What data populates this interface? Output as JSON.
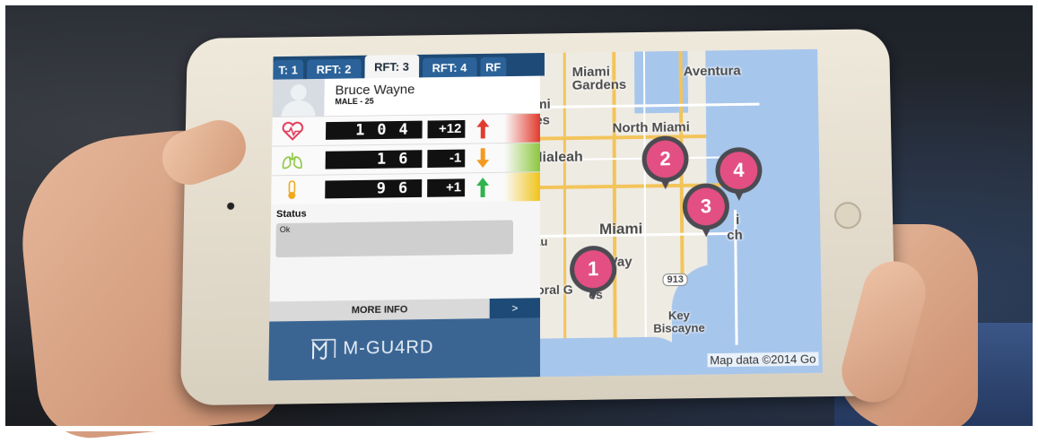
{
  "tabs": [
    {
      "label": "T: 1",
      "active": false
    },
    {
      "label": "RFT: 2",
      "active": false
    },
    {
      "label": "RFT: 3",
      "active": true
    },
    {
      "label": "RFT: 4",
      "active": false
    },
    {
      "label": "RF",
      "active": false
    }
  ],
  "patient": {
    "name": "Bruce Wayne",
    "info": "MALE - 25"
  },
  "vitals": [
    {
      "icon": "heart-rate-icon",
      "value": "104",
      "delta": "+12",
      "trend": "up",
      "trend_color": "#e23b2e",
      "status_color": "#e23b2e"
    },
    {
      "icon": "lungs-icon",
      "value": "16",
      "delta": "-1",
      "trend": "down",
      "trend_color": "#f39a1e",
      "status_color": "#8cc63f"
    },
    {
      "icon": "thermometer-icon",
      "value": "96",
      "delta": "+1",
      "trend": "up",
      "trend_color": "#2fb34a",
      "status_color": "#f0c419"
    }
  ],
  "status": {
    "label": "Status",
    "value": "Ok"
  },
  "more_info": {
    "label": "MORE INFO",
    "arrow": ">"
  },
  "brand": {
    "name": "M-GU4RD"
  },
  "map": {
    "labels": [
      "Miami Gardens",
      "Aventura",
      "ami",
      "kes",
      "North Miami",
      "Hialeah",
      "Miami",
      "i",
      "ch",
      "eau",
      "Way",
      "913",
      "Coral G",
      "es",
      "Key Biscayne"
    ],
    "credit": "Map data ©2014 Go",
    "pins": [
      "1",
      "2",
      "3",
      "4"
    ],
    "pin_color": "#e34f82"
  },
  "colors": {
    "header_blue": "#1d4a76",
    "tab_blue": "#2b6299",
    "brand_blue": "#3a6593"
  }
}
